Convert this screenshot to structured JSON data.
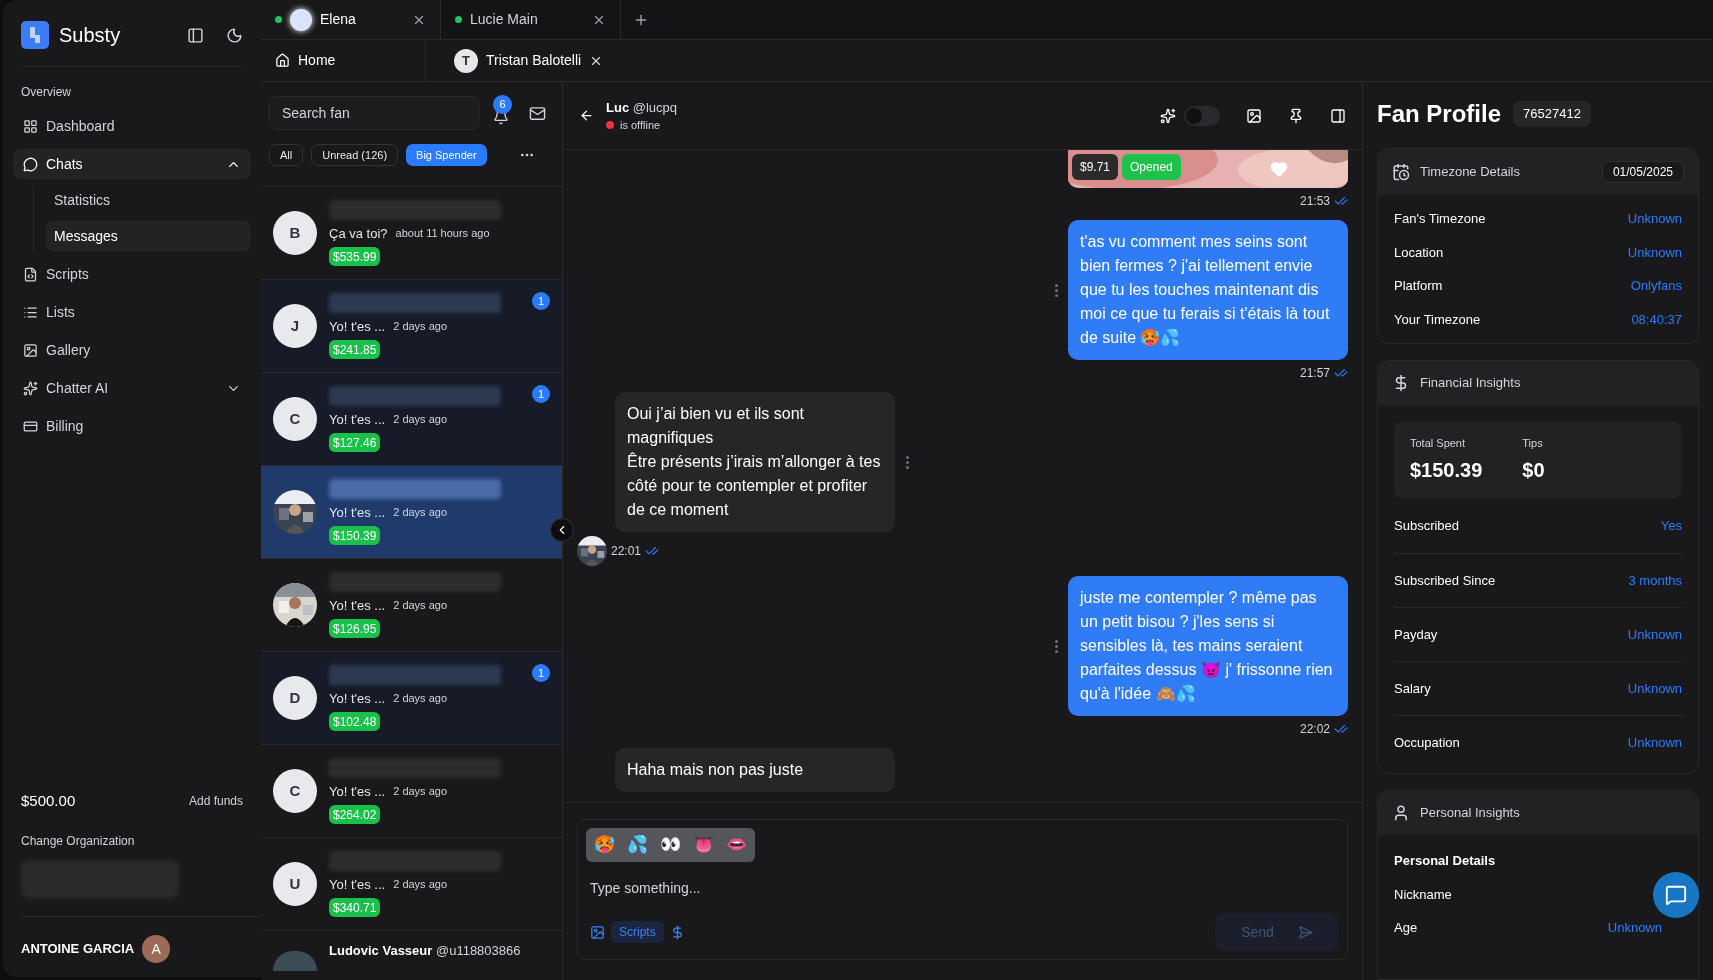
{
  "sidebar": {
    "brand": "Substy",
    "section": "Overview",
    "items": [
      {
        "label": "Dashboard",
        "selected": false
      },
      {
        "label": "Chats",
        "selected": false,
        "expanded": true,
        "children": [
          {
            "label": "Statistics",
            "selected": false
          },
          {
            "label": "Messages",
            "selected": true
          }
        ]
      },
      {
        "label": "Scripts",
        "selected": false
      },
      {
        "label": "Lists",
        "selected": false
      },
      {
        "label": "Gallery",
        "selected": false
      },
      {
        "label": "Chatter AI",
        "selected": false,
        "expanded": false
      },
      {
        "label": "Billing",
        "selected": false
      }
    ],
    "balance": "$500.00",
    "add_funds": "Add funds",
    "change_org": "Change Organization",
    "user": {
      "name": "ANTOINE GARCIA",
      "initial": "A"
    }
  },
  "tabs": [
    {
      "label": "Elena",
      "selected": true,
      "online": true,
      "avatar": true
    },
    {
      "label": "Lucie Main",
      "selected": false,
      "online": true,
      "avatar": false
    }
  ],
  "subtabs": [
    {
      "label": "Home",
      "kind": "home"
    },
    {
      "label": "Tristan Balotelli",
      "kind": "person",
      "initial": "T"
    }
  ],
  "chat_list": {
    "search": {
      "placeholder": "Search fan"
    },
    "notifications": "6",
    "filters": [
      {
        "label": "All",
        "selected": false
      },
      {
        "label": "Unread (126)",
        "selected": false
      },
      {
        "label": "Big Spender",
        "selected": true
      }
    ],
    "items": [
      {
        "kind": "letter",
        "initial": "B",
        "preview": "Ça va toi?",
        "time": "about 11 hours ago",
        "amount": "$535.99",
        "unread": false,
        "selected": false
      },
      {
        "kind": "letter",
        "initial": "J",
        "preview": "Yo! t'es ...",
        "time": "2 days ago",
        "amount": "$241.85",
        "unread": true,
        "badge": "1",
        "selected": false
      },
      {
        "kind": "letter",
        "initial": "C",
        "preview": "Yo! t'es ...",
        "time": "2 days ago",
        "amount": "$127.46",
        "unread": true,
        "badge": "1",
        "selected": false
      },
      {
        "preview": "Yo! t'es ...",
        "time": "2 days ago",
        "amount": "$150.39",
        "unread": false,
        "selected": true
      },
      {
        "preview": "Yo! t'es ...",
        "time": "2 days ago",
        "amount": "$126.95",
        "unread": false,
        "selected": false
      },
      {
        "kind": "letter",
        "initial": "D",
        "preview": "Yo! t'es ...",
        "time": "2 days ago",
        "amount": "$102.48",
        "unread": true,
        "badge": "1",
        "selected": false
      },
      {
        "kind": "letter",
        "initial": "C",
        "preview": "Yo! t'es ...",
        "time": "2 days ago",
        "amount": "$264.02",
        "unread": false,
        "selected": false
      },
      {
        "kind": "letter",
        "initial": "U",
        "preview": "Yo! t'es ...",
        "time": "2 days ago",
        "amount": "$340.71",
        "unread": false,
        "selected": false
      }
    ],
    "last": {
      "name": "Ludovic Vasseur",
      "handle": "@u118803866"
    }
  },
  "chat": {
    "name": "Luc",
    "handle": "@lucpq",
    "status": "is offline",
    "online": false,
    "ai_toggle": {
      "on": false
    },
    "messages": [
      {
        "kind": "media",
        "price": "$9.71",
        "status": "Opened",
        "time": "21:53"
      },
      {
        "kind": "sent",
        "text": "t'as vu comment mes seins sont bien fermes ? j'ai tellement envie que tu les touches maintenant dis moi ce que tu ferais si t'étais là tout de suite 🥵💦",
        "time": "21:57"
      },
      {
        "kind": "received",
        "text": "Oui j’ai bien vu et ils sont magnifiques\nÊtre présents j’irais m’allonger à tes côté pour te contempler et profiter de ce moment",
        "time": "22:01"
      },
      {
        "kind": "sent",
        "text": "juste me contempler ? même pas un petit bisou ? j'les sens si sensibles là, tes mains seraient parfaites dessus 😈 j' frissonne rien qu'à l'idée 🙈💦",
        "time": "22:02"
      },
      {
        "kind": "received",
        "text": "Haha mais non pas juste"
      }
    ],
    "composer": {
      "emojis": [
        "🥵",
        "💦",
        "👀",
        "👅",
        "👄"
      ],
      "placeholder": "Type something...",
      "scripts": "Scripts",
      "send": "Send"
    }
  },
  "profile": {
    "title": "Fan Profile",
    "id": "76527412",
    "timezone": {
      "title": "Timezone Details",
      "date": "01/05/2025",
      "rows": [
        {
          "label": "Fan's Timezone",
          "value": "Unknown"
        },
        {
          "label": "Location",
          "value": "Unknown"
        },
        {
          "label": "Platform",
          "value": "Onlyfans"
        },
        {
          "label": "Your Timezone",
          "value": "08:40:37"
        }
      ]
    },
    "financial": {
      "title": "Financial Insights",
      "stats": [
        {
          "label": "Total Spent",
          "value": "$150.39"
        },
        {
          "label": "Tips",
          "value": "$0"
        }
      ],
      "rows": [
        {
          "label": "Subscribed",
          "value": "Yes"
        },
        {
          "label": "Subscribed Since",
          "value": "3 months"
        },
        {
          "label": "Payday",
          "value": "Unknown"
        },
        {
          "label": "Salary",
          "value": "Unknown"
        },
        {
          "label": "Occupation",
          "value": "Unknown"
        }
      ]
    },
    "personal": {
      "title": "Personal Insights",
      "heading": "Personal Details",
      "rows": [
        {
          "label": "Nickname"
        },
        {
          "label": "Age",
          "value": "Unknown"
        }
      ]
    }
  }
}
